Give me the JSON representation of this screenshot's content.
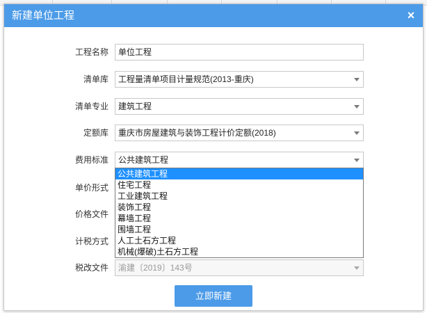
{
  "dialog": {
    "title": "新建单位工程",
    "close_symbol": "×"
  },
  "form": {
    "project_name": {
      "label": "工程名称",
      "value": "单位工程"
    },
    "bill_library": {
      "label": "清单库",
      "value": "工程量清单项目计量规范(2013-重庆)"
    },
    "bill_specialty": {
      "label": "清单专业",
      "value": "建筑工程"
    },
    "quota_library": {
      "label": "定额库",
      "value": "重庆市房屋建筑与装饰工程计价定额(2018)"
    },
    "fee_standard": {
      "label": "费用标准",
      "value": "公共建筑工程",
      "options": [
        "公共建筑工程",
        "住宅工程",
        "工业建筑工程",
        "装饰工程",
        "幕墙工程",
        "围墙工程",
        "人工土石方工程",
        "机械(爆破)土石方工程"
      ],
      "selected_index": 0
    },
    "unit_price_form": {
      "label": "单价形式"
    },
    "price_file": {
      "label": "价格文件"
    },
    "tax_method": {
      "label": "计税方式"
    },
    "tax_reform_file": {
      "label": "税改文件",
      "value": "渝建〔2019〕143号"
    }
  },
  "actions": {
    "create_label": "立即新建"
  },
  "colors": {
    "accent": "#4c9be8",
    "selection": "#1e90ff"
  },
  "icons": {
    "close": "close-icon",
    "dropdown": "chevron-down-icon"
  }
}
